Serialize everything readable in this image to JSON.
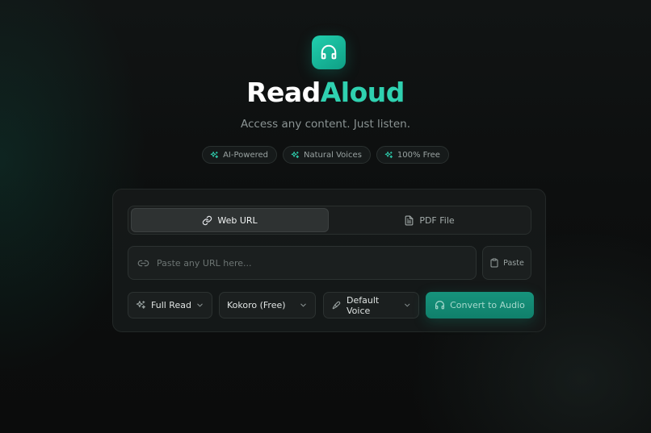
{
  "brand": {
    "title_part1": "Read",
    "title_part2": "Aloud",
    "tagline": "Access any content. Just listen.",
    "accent_color": "#2fd1b0",
    "logo_icon": "headphones-icon"
  },
  "badges": [
    {
      "icon": "sparkles-icon",
      "label": "AI-Powered"
    },
    {
      "icon": "sparkles-icon",
      "label": "Natural Voices"
    },
    {
      "icon": "sparkles-icon",
      "label": "100% Free"
    }
  ],
  "tabs": [
    {
      "icon": "link-icon",
      "label": "Web URL",
      "active": true
    },
    {
      "icon": "file-icon",
      "label": "PDF File",
      "active": false
    }
  ],
  "url_input": {
    "icon": "link-icon",
    "value": "",
    "placeholder": "Paste any URL here..."
  },
  "paste_button": {
    "icon": "clipboard-icon",
    "label": "Paste"
  },
  "controls": {
    "mode": {
      "icon": "sparkles-icon",
      "selected": "Full Read"
    },
    "engine": {
      "selected": "Kokoro (Free)"
    },
    "voice": {
      "icon": "mic-icon",
      "selected": "Default Voice"
    }
  },
  "convert_button": {
    "icon": "headphones-icon",
    "label": "Convert to Audio"
  }
}
